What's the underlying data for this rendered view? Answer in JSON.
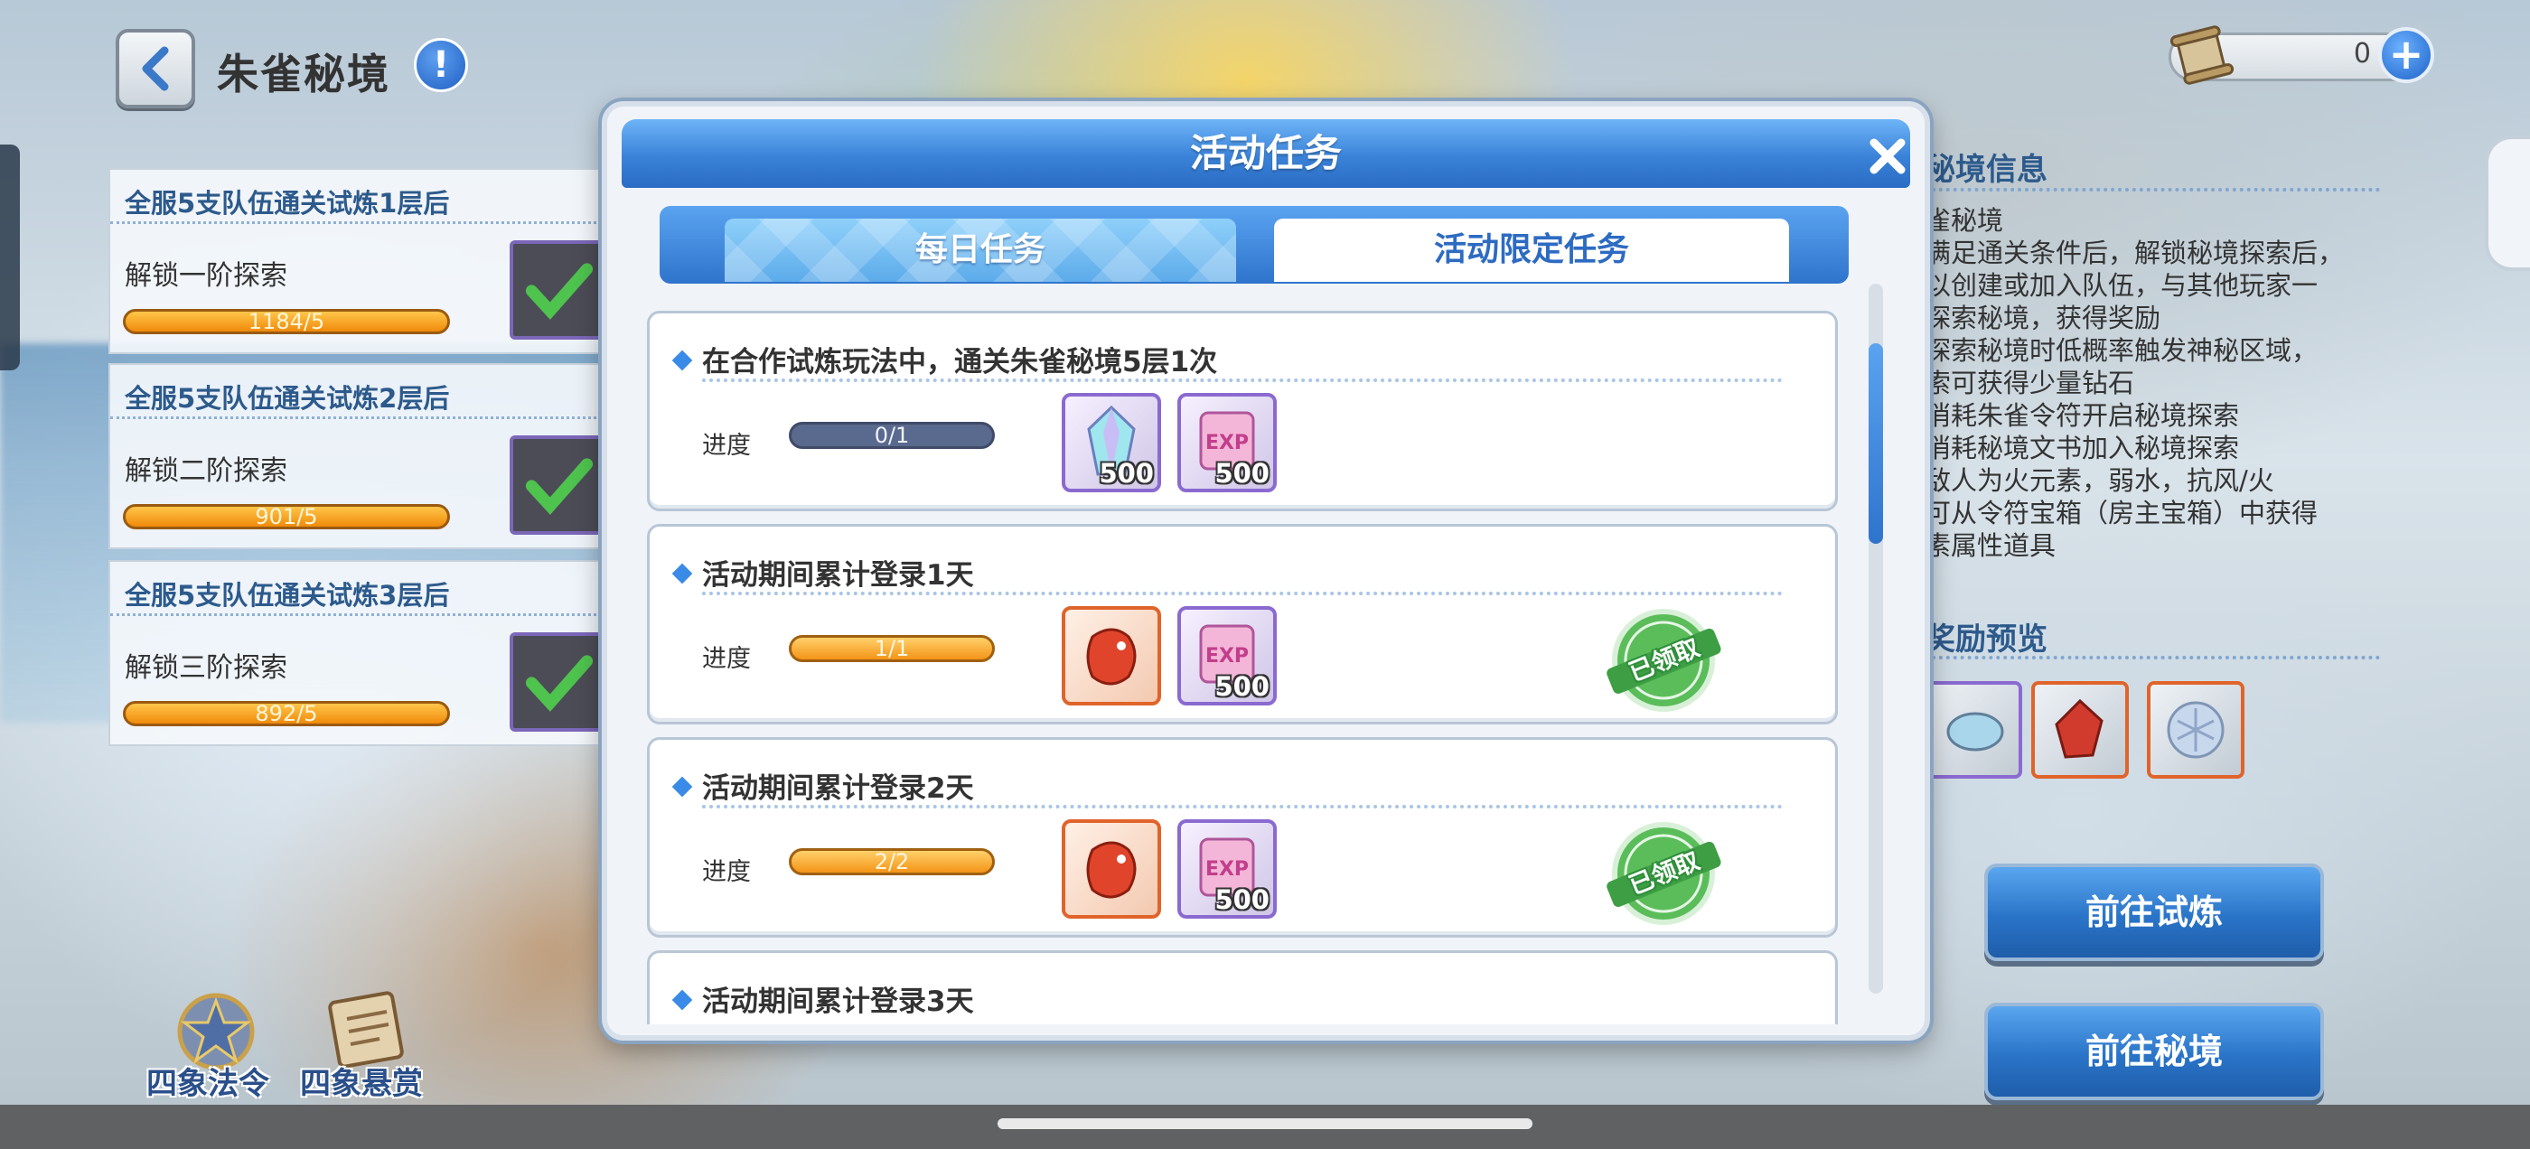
{
  "header": {
    "title": "朱雀秘境"
  },
  "currency": {
    "value": "0"
  },
  "unlock_cards": [
    {
      "title": "全服5支队伍通关试炼1层后",
      "label": "解锁一阶探索",
      "progress": "1184/5"
    },
    {
      "title": "全服5支队伍通关试炼2层后",
      "label": "解锁二阶探索",
      "progress": "901/5"
    },
    {
      "title": "全服5支队伍通关试炼3层后",
      "label": "解锁三阶探索",
      "progress": "892/5"
    }
  ],
  "info_panel": {
    "title": "秘境信息",
    "lines": [
      "雀秘境",
      "满足通关条件后，解锁秘境探索后，",
      "以创建或加入队伍，与其他玩家一",
      "探索秘境，获得奖励",
      "探索秘境时低概率触发神秘区域，",
      "索可获得少量钻石",
      "消耗朱雀令符开启秘境探索",
      "消耗秘境文书加入秘境探索",
      "敌人为火元素，弱水，抗风/火",
      "可从令符宝箱（房主宝箱）中获得",
      "素属性道具"
    ],
    "reward_title": "奖励预览"
  },
  "buttons": {
    "go_trial": "前往试炼",
    "go_realm": "前往秘境"
  },
  "bottom_icons": {
    "order": "四象法令",
    "bounty": "四象悬赏"
  },
  "modal": {
    "title": "活动任务",
    "tabs": {
      "daily": "每日任务",
      "limited": "活动限定任务"
    },
    "progress_label": "进度",
    "claimed_label": "已领取",
    "tasks": [
      {
        "name": "在合作试炼玩法中，通关朱雀秘境5层1次",
        "progress": "0/1",
        "reward1_qty": "500",
        "reward2_qty": "500"
      },
      {
        "name": "活动期间累计登录1天",
        "progress": "1/1",
        "reward1_qty": "",
        "reward2_qty": "500"
      },
      {
        "name": "活动期间累计登录2天",
        "progress": "2/2",
        "reward1_qty": "",
        "reward2_qty": "500"
      },
      {
        "name": "活动期间累计登录3天"
      }
    ]
  }
}
